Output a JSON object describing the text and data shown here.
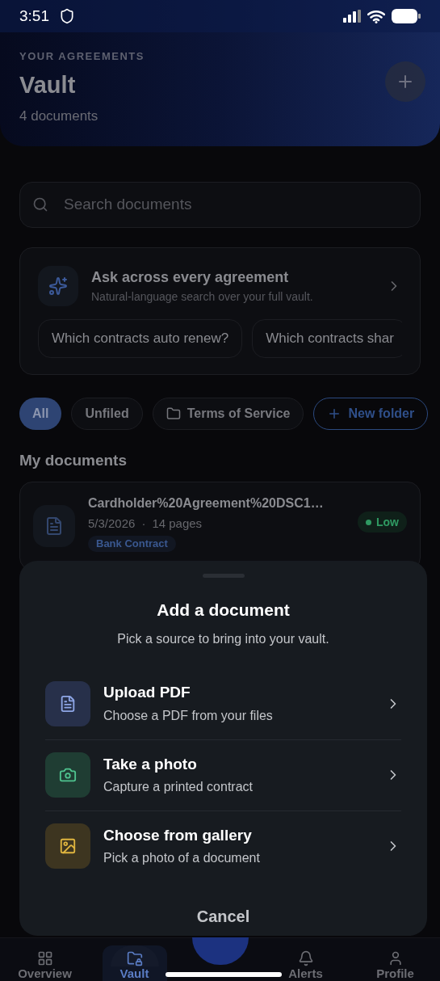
{
  "status_bar": {
    "time": "3:51"
  },
  "header": {
    "eyebrow": "YOUR AGREEMENTS",
    "title": "Vault",
    "subtitle": "4 documents"
  },
  "search": {
    "placeholder": "Search documents"
  },
  "ask_card": {
    "title": "Ask across every agreement",
    "subtitle": "Natural-language search over your full vault.",
    "suggestions": [
      "Which contracts auto renew?",
      "Which contracts shar"
    ]
  },
  "filters": [
    {
      "label": "All",
      "kind": "filter",
      "selected": true
    },
    {
      "label": "Unfiled",
      "kind": "filter",
      "selected": false
    },
    {
      "label": "Terms of Service",
      "kind": "folder",
      "selected": false
    },
    {
      "label": "New folder",
      "kind": "action"
    }
  ],
  "section_title": "My documents",
  "documents": [
    {
      "name": "Cardholder%20Agreement%20DSC1…",
      "date": "5/3/2026",
      "separator": "·",
      "pages": "14 pages",
      "risk": {
        "label": "Low",
        "color": "#2f9a62"
      },
      "tag": "Bank Contract"
    }
  ],
  "sheet": {
    "title": "Add a document",
    "subtitle": "Pick a source to bring into your vault.",
    "options": [
      {
        "kind": "pdf",
        "title": "Upload PDF",
        "subtitle": "Choose a PDF from your files"
      },
      {
        "kind": "camera",
        "title": "Take a photo",
        "subtitle": "Capture a printed contract"
      },
      {
        "kind": "gallery",
        "title": "Choose from gallery",
        "subtitle": "Pick a photo of a document"
      }
    ],
    "cancel": "Cancel"
  },
  "nav": [
    {
      "kind": "overview",
      "label": "Overview",
      "selected": false
    },
    {
      "kind": "vault",
      "label": "Vault",
      "selected": true
    },
    {
      "kind": "alerts",
      "label": "Alerts",
      "selected": false
    },
    {
      "kind": "profile",
      "label": "Profile",
      "selected": false
    }
  ]
}
